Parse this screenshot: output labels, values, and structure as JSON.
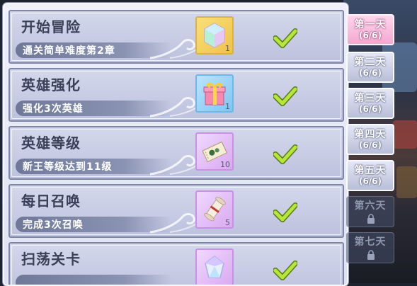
{
  "tasks": [
    {
      "title": "开始冒险",
      "desc": "通关简单难度第2章",
      "reward_icon": "crystal-icon",
      "reward_count": "1",
      "completed": true
    },
    {
      "title": "英雄强化",
      "desc": "强化3次英雄",
      "reward_icon": "gift-box-icon",
      "reward_count": "1",
      "completed": true
    },
    {
      "title": "英雄等级",
      "desc": "新王等级达到11级",
      "reward_icon": "ticket-icon",
      "reward_count": "10",
      "completed": true
    },
    {
      "title": "每日召唤",
      "desc": "完成3次召唤",
      "reward_icon": "scroll-icon",
      "reward_count": "5",
      "completed": true
    },
    {
      "title": "扫荡关卡",
      "desc": "",
      "reward_icon": "gem-icon",
      "reward_count": "",
      "completed": true
    }
  ],
  "days": [
    {
      "label": "第一天",
      "progress": "(6/6)",
      "state": "active"
    },
    {
      "label": "第二天",
      "progress": "(6/6)",
      "state": "done"
    },
    {
      "label": "第三天",
      "progress": "(6/6)",
      "state": "done"
    },
    {
      "label": "第四天",
      "progress": "(6/6)",
      "state": "done"
    },
    {
      "label": "第五天",
      "progress": "(6/6)",
      "state": "done"
    },
    {
      "label": "第六天",
      "progress": "",
      "state": "locked"
    },
    {
      "label": "第七天",
      "progress": "",
      "state": "locked"
    }
  ],
  "colors": {
    "panel": "#dfe3f2",
    "task_bg": "#c6cae3",
    "task_border": "#8086a8",
    "title_text": "#3b3f58",
    "check_green": "#a4d62a",
    "tab_active": "#f3a7cf",
    "tab_done": "#b9bfd9",
    "tab_locked": "#464e69"
  }
}
